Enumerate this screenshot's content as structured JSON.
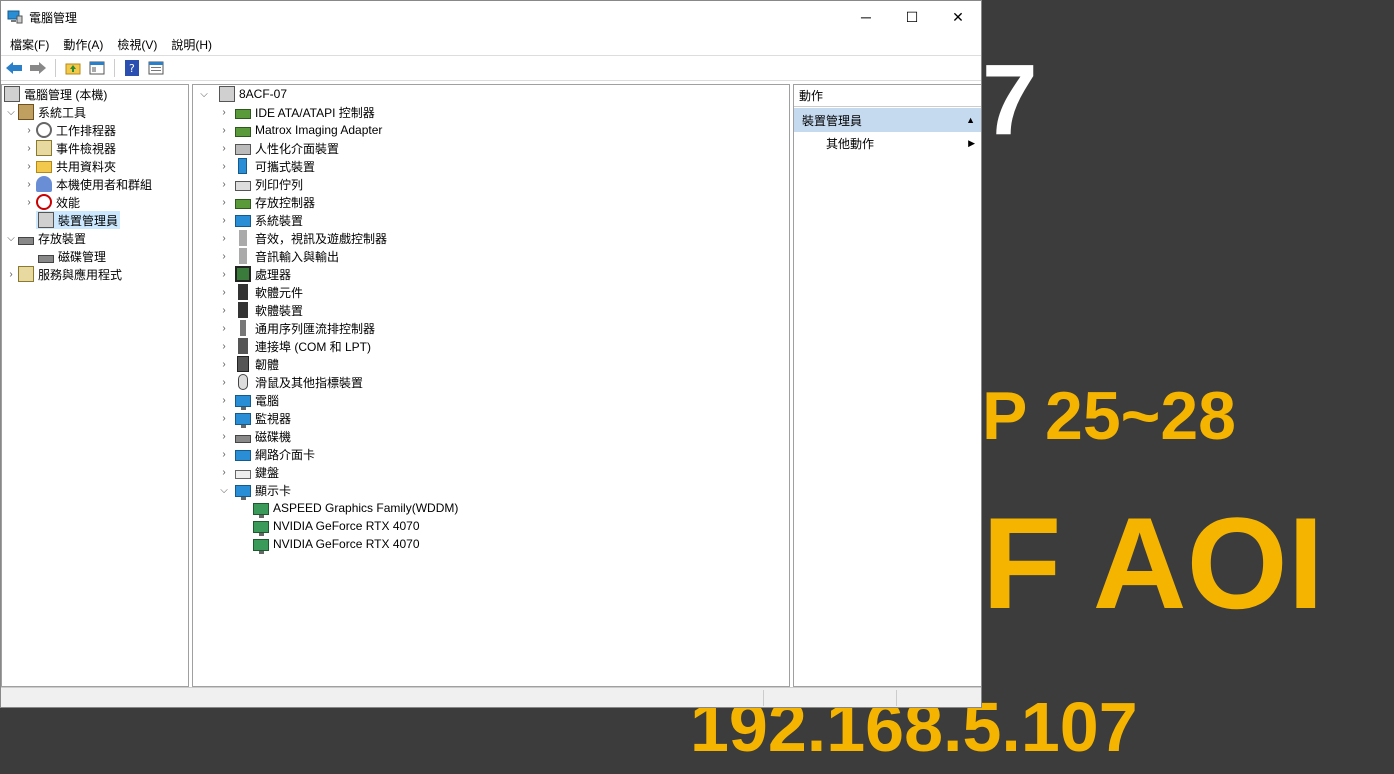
{
  "window": {
    "title": "電腦管理",
    "controls": {
      "minimize": "─",
      "maximize": "☐",
      "close": "✕"
    }
  },
  "menu": [
    "檔案(F)",
    "動作(A)",
    "檢視(V)",
    "說明(H)"
  ],
  "toolbar_icons": [
    "back-arrow-icon",
    "forward-arrow-icon",
    "up-folder-icon",
    "show-hide-tree-icon",
    "help-icon",
    "properties-icon"
  ],
  "left_tree": {
    "root": "電腦管理 (本機)",
    "system_tools": "系統工具",
    "task_scheduler": "工作排程器",
    "event_viewer": "事件檢視器",
    "shared_folders": "共用資料夾",
    "local_users": "本機使用者和群組",
    "performance": "效能",
    "device_manager": "裝置管理員",
    "storage": "存放裝置",
    "disk_management": "磁碟管理",
    "services_apps": "服務與應用程式"
  },
  "device_tree": {
    "computer": "8ACF-07",
    "categories": [
      "IDE ATA/ATAPI 控制器",
      "Matrox Imaging Adapter",
      "人性化介面裝置",
      "可攜式裝置",
      "列印佇列",
      "存放控制器",
      "系統裝置",
      "音效，視訊及遊戲控制器",
      "音訊輸入與輸出",
      "處理器",
      "軟體元件",
      "軟體裝置",
      "通用序列匯流排控制器",
      "連接埠 (COM 和 LPT)",
      "韌體",
      "滑鼠及其他指標裝置",
      "電腦",
      "監視器",
      "磁碟機",
      "網路介面卡",
      "鍵盤"
    ],
    "display_adapters": "顯示卡",
    "display_children": [
      "ASPEED Graphics Family(WDDM)",
      "NVIDIA GeForce RTX 4070",
      "NVIDIA GeForce RTX 4070"
    ]
  },
  "actions": {
    "header": "動作",
    "section": "裝置管理員",
    "more": "其他動作"
  },
  "wallpaper": {
    "top": "7",
    "mid": "P 25~28",
    "big": "F AOI",
    "ip": "192.168.5.107"
  }
}
